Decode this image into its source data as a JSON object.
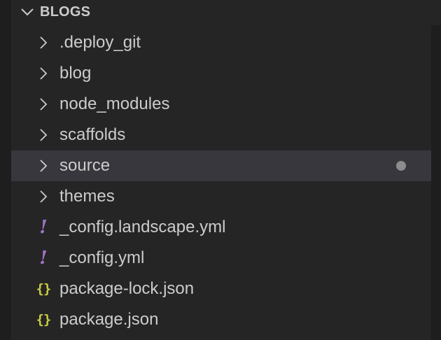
{
  "explorer": {
    "section_title": "BLOGS",
    "items": [
      {
        "type": "folder",
        "label": ".deploy_git",
        "icon": "chevron-right-icon"
      },
      {
        "type": "folder",
        "label": "blog",
        "icon": "chevron-right-icon"
      },
      {
        "type": "folder",
        "label": "node_modules",
        "icon": "chevron-right-icon"
      },
      {
        "type": "folder",
        "label": "scaffolds",
        "icon": "chevron-right-icon"
      },
      {
        "type": "folder",
        "label": "source",
        "icon": "chevron-right-icon",
        "selected": true,
        "has_changes": true
      },
      {
        "type": "folder",
        "label": "themes",
        "icon": "chevron-right-icon"
      },
      {
        "type": "file",
        "label": "_config.landscape.yml",
        "icon": "yaml-file-icon",
        "icon_glyph": "!"
      },
      {
        "type": "file",
        "label": "_config.yml",
        "icon": "yaml-file-icon",
        "icon_glyph": "!"
      },
      {
        "type": "file",
        "label": "package-lock.json",
        "icon": "json-file-icon",
        "icon_glyph": "{}"
      },
      {
        "type": "file",
        "label": "package.json",
        "icon": "json-file-icon",
        "icon_glyph": "{}"
      }
    ]
  },
  "colors": {
    "background": "#252526",
    "selected_row": "#37373d",
    "text": "#cccccc",
    "yaml_icon": "#a074c4",
    "json_icon": "#cbcb41",
    "modified_dot": "#8c8c8c"
  }
}
